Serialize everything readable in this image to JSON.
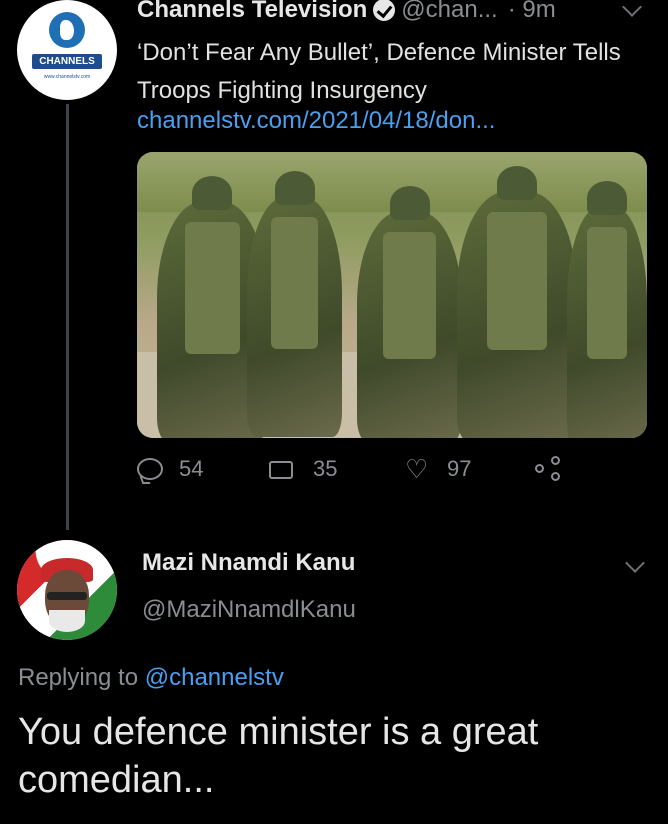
{
  "tweet1": {
    "avatar_wordmark": "CHANNELS",
    "avatar_url_text": "www.channelstv.com",
    "display_name": "Channels Television",
    "handle": "@chan...",
    "time": "· 9m",
    "text": "‘Don’t Fear Any Bullet’, Defence Minister Tells Troops Fighting Insurgency",
    "link": "channelstv.com/2021/04/18/don...",
    "replies": "54",
    "retweets": "35",
    "likes": "97"
  },
  "tweet2": {
    "display_name": "Mazi Nnamdi Kanu",
    "handle": "@MaziNnamdlKanu",
    "replying_prefix": "Replying to ",
    "replying_to": "@channelstv",
    "text": "You defence minister is a great comedian..."
  },
  "icons": [
    "verified-icon",
    "chevron-down-icon",
    "reply-icon",
    "retweet-icon",
    "like-icon",
    "share-icon"
  ],
  "colors": {
    "background": "#000000",
    "link": "#4a9ff0",
    "muted": "#8a8d91",
    "text": "#e2e2e2"
  }
}
